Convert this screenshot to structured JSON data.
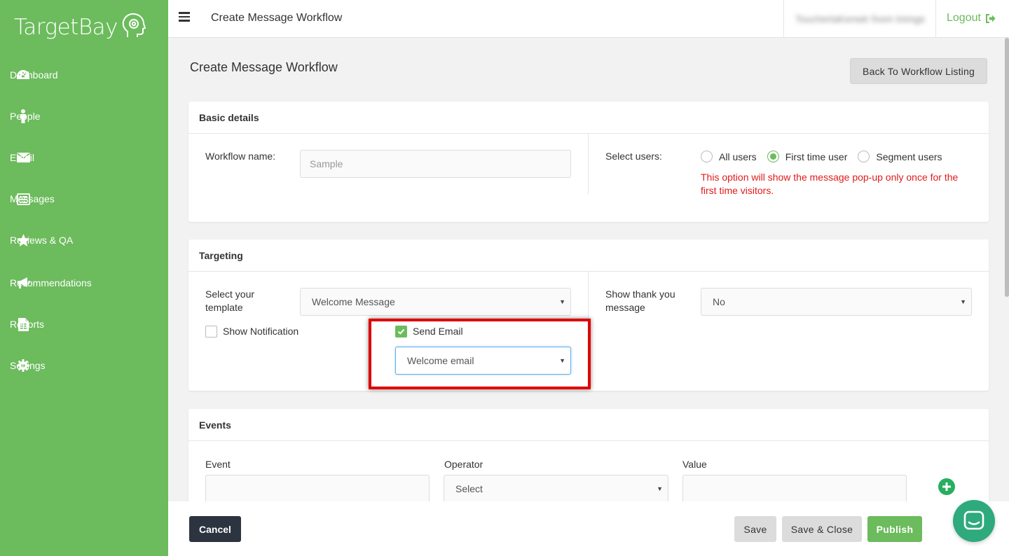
{
  "app": {
    "logo_text": "TargetBay"
  },
  "sidebar": {
    "items": [
      {
        "label": "Dashboard",
        "icon": "dashboard-icon"
      },
      {
        "label": "People",
        "icon": "person-icon"
      },
      {
        "label": "Email",
        "icon": "envelope-icon"
      },
      {
        "label": "Messages",
        "icon": "messages-icon"
      },
      {
        "label": "Reviews & QA",
        "icon": "star-icon"
      },
      {
        "label": "Recommendations",
        "icon": "megaphone-icon"
      },
      {
        "label": "Reports",
        "icon": "document-icon"
      },
      {
        "label": "Settings",
        "icon": "gear-icon"
      }
    ]
  },
  "topbar": {
    "title": "Create Message Workflow",
    "user_blurred": "TouchertaKenwtr fnom lnimge",
    "logout_label": "Logout"
  },
  "page": {
    "title": "Create Message Workflow",
    "back_button": "Back To Workflow Listing"
  },
  "basic": {
    "heading": "Basic details",
    "workflow_label": "Workflow name:",
    "workflow_placeholder": "Sample",
    "select_users_label": "Select users:",
    "user_options": [
      {
        "label": "All users",
        "selected": false
      },
      {
        "label": "First time user",
        "selected": true
      },
      {
        "label": "Segment users",
        "selected": false
      }
    ],
    "warning_line1": "This option will show the message pop-up only once for the",
    "warning_line2": "first time visitors."
  },
  "targeting": {
    "heading": "Targeting",
    "template_label_1": "Select your",
    "template_label_2": "template",
    "template_value": "Welcome Message",
    "thank_label_1": "Show thank you",
    "thank_label_2": "message",
    "thank_value": "No",
    "show_notification_label": "Show Notification",
    "show_notification_checked": false,
    "send_email_label": "Send Email",
    "send_email_checked": true,
    "email_template_value": "Welcome email"
  },
  "events": {
    "heading": "Events",
    "event_label": "Event",
    "operator_label": "Operator",
    "operator_value": "Select",
    "value_label": "Value"
  },
  "footer": {
    "cancel": "Cancel",
    "save": "Save",
    "save_close": "Save & Close",
    "publish": "Publish"
  },
  "colors": {
    "brand_green": "#6cbb5d",
    "warning_red": "#e01b1b",
    "highlight_red": "#e00000",
    "dark_button": "#2c3440",
    "chat_green": "#2eaa7c"
  }
}
